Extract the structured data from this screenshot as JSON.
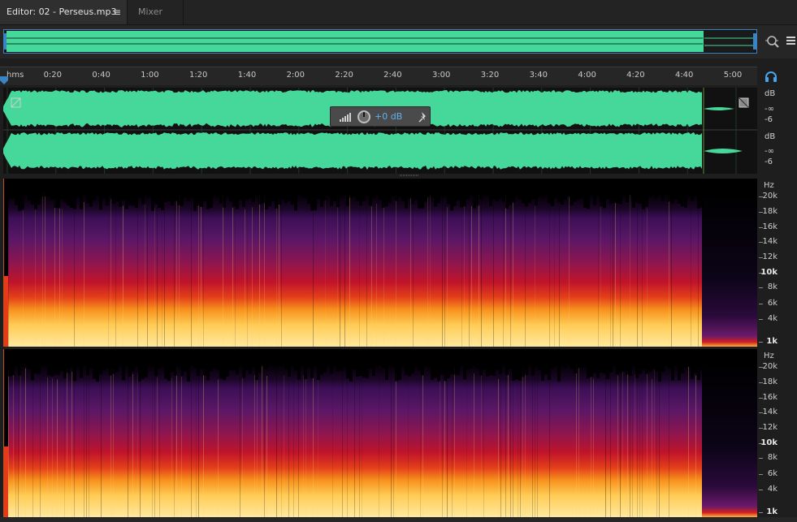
{
  "tabs": {
    "editor_label": "Editor: 02 - Perseus.mp3",
    "editor_menu_glyph": "≡",
    "mixer_label": "Mixer"
  },
  "ruler": {
    "unit": "hms",
    "ticks": [
      "0:20",
      "0:40",
      "1:00",
      "1:20",
      "1:40",
      "2:00",
      "2:20",
      "2:40",
      "3:00",
      "3:20",
      "3:40",
      "4:00",
      "4:20",
      "4:40",
      "5:00"
    ]
  },
  "db_scale": {
    "channel1": {
      "unit": "dB",
      "inf": "-∞",
      "low": "-6"
    },
    "channel2": {
      "unit": "dB",
      "inf": "-∞",
      "low": "-6"
    }
  },
  "hud": {
    "value": "+0 dB"
  },
  "hz_scale": {
    "unit": "Hz",
    "labels": [
      "20k",
      "18k",
      "16k",
      "14k",
      "12k",
      "10k",
      "8k",
      "6k",
      "4k",
      "1k"
    ],
    "bold": [
      "10k",
      "1k"
    ]
  },
  "colors": {
    "waveform": "#45d89a",
    "selection_border": "#3b84c4",
    "hud_value": "#5fb2ef",
    "spectral_low": "#2a0a3a",
    "spectral_mid": "#c0142a",
    "spectral_high": "#ffe07a"
  },
  "icons": {
    "zoom": "zoom-magnifier-icon",
    "panel_menu": "panel-menu-icon",
    "headphones": "headphones-icon",
    "pin": "pin-icon",
    "hud_meter": "meter-icon",
    "knob": "volume-knob-icon"
  }
}
